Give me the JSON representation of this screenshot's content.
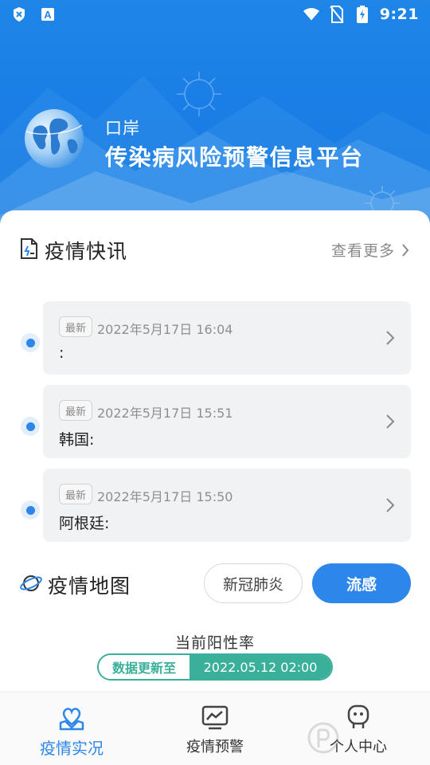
{
  "status_bar": {
    "time": "9:21"
  },
  "header": {
    "subtitle": "口岸",
    "title": "传染病风险预警信息平台"
  },
  "news_section": {
    "title": "疫情快讯",
    "more_label": "查看更多",
    "items": [
      {
        "tag": "最新",
        "time": "2022年5月17日 16:04",
        "text": ":"
      },
      {
        "tag": "最新",
        "time": "2022年5月17日 15:51",
        "text": "韩国:"
      },
      {
        "tag": "最新",
        "time": "2022年5月17日 15:50",
        "text": "阿根廷:"
      }
    ]
  },
  "map_section": {
    "title": "疫情地图",
    "tabs": [
      {
        "label": "新冠肺炎",
        "active": false
      },
      {
        "label": "流感",
        "active": true
      }
    ],
    "rate_title": "当前阳性率",
    "update_label": "数据更新至",
    "update_value": "2022.05.12 02:00"
  },
  "bottom_nav": {
    "items": [
      {
        "label": "疫情实况",
        "icon": "map-heart-icon",
        "active": true
      },
      {
        "label": "疫情预警",
        "icon": "warning-chart-icon",
        "active": false
      },
      {
        "label": "个人中心",
        "icon": "robot-face-icon",
        "active": false
      }
    ]
  },
  "colors": {
    "primary_blue": "#2d86ea",
    "header_blue": "#1f86e8",
    "teal": "#3ab09a"
  }
}
